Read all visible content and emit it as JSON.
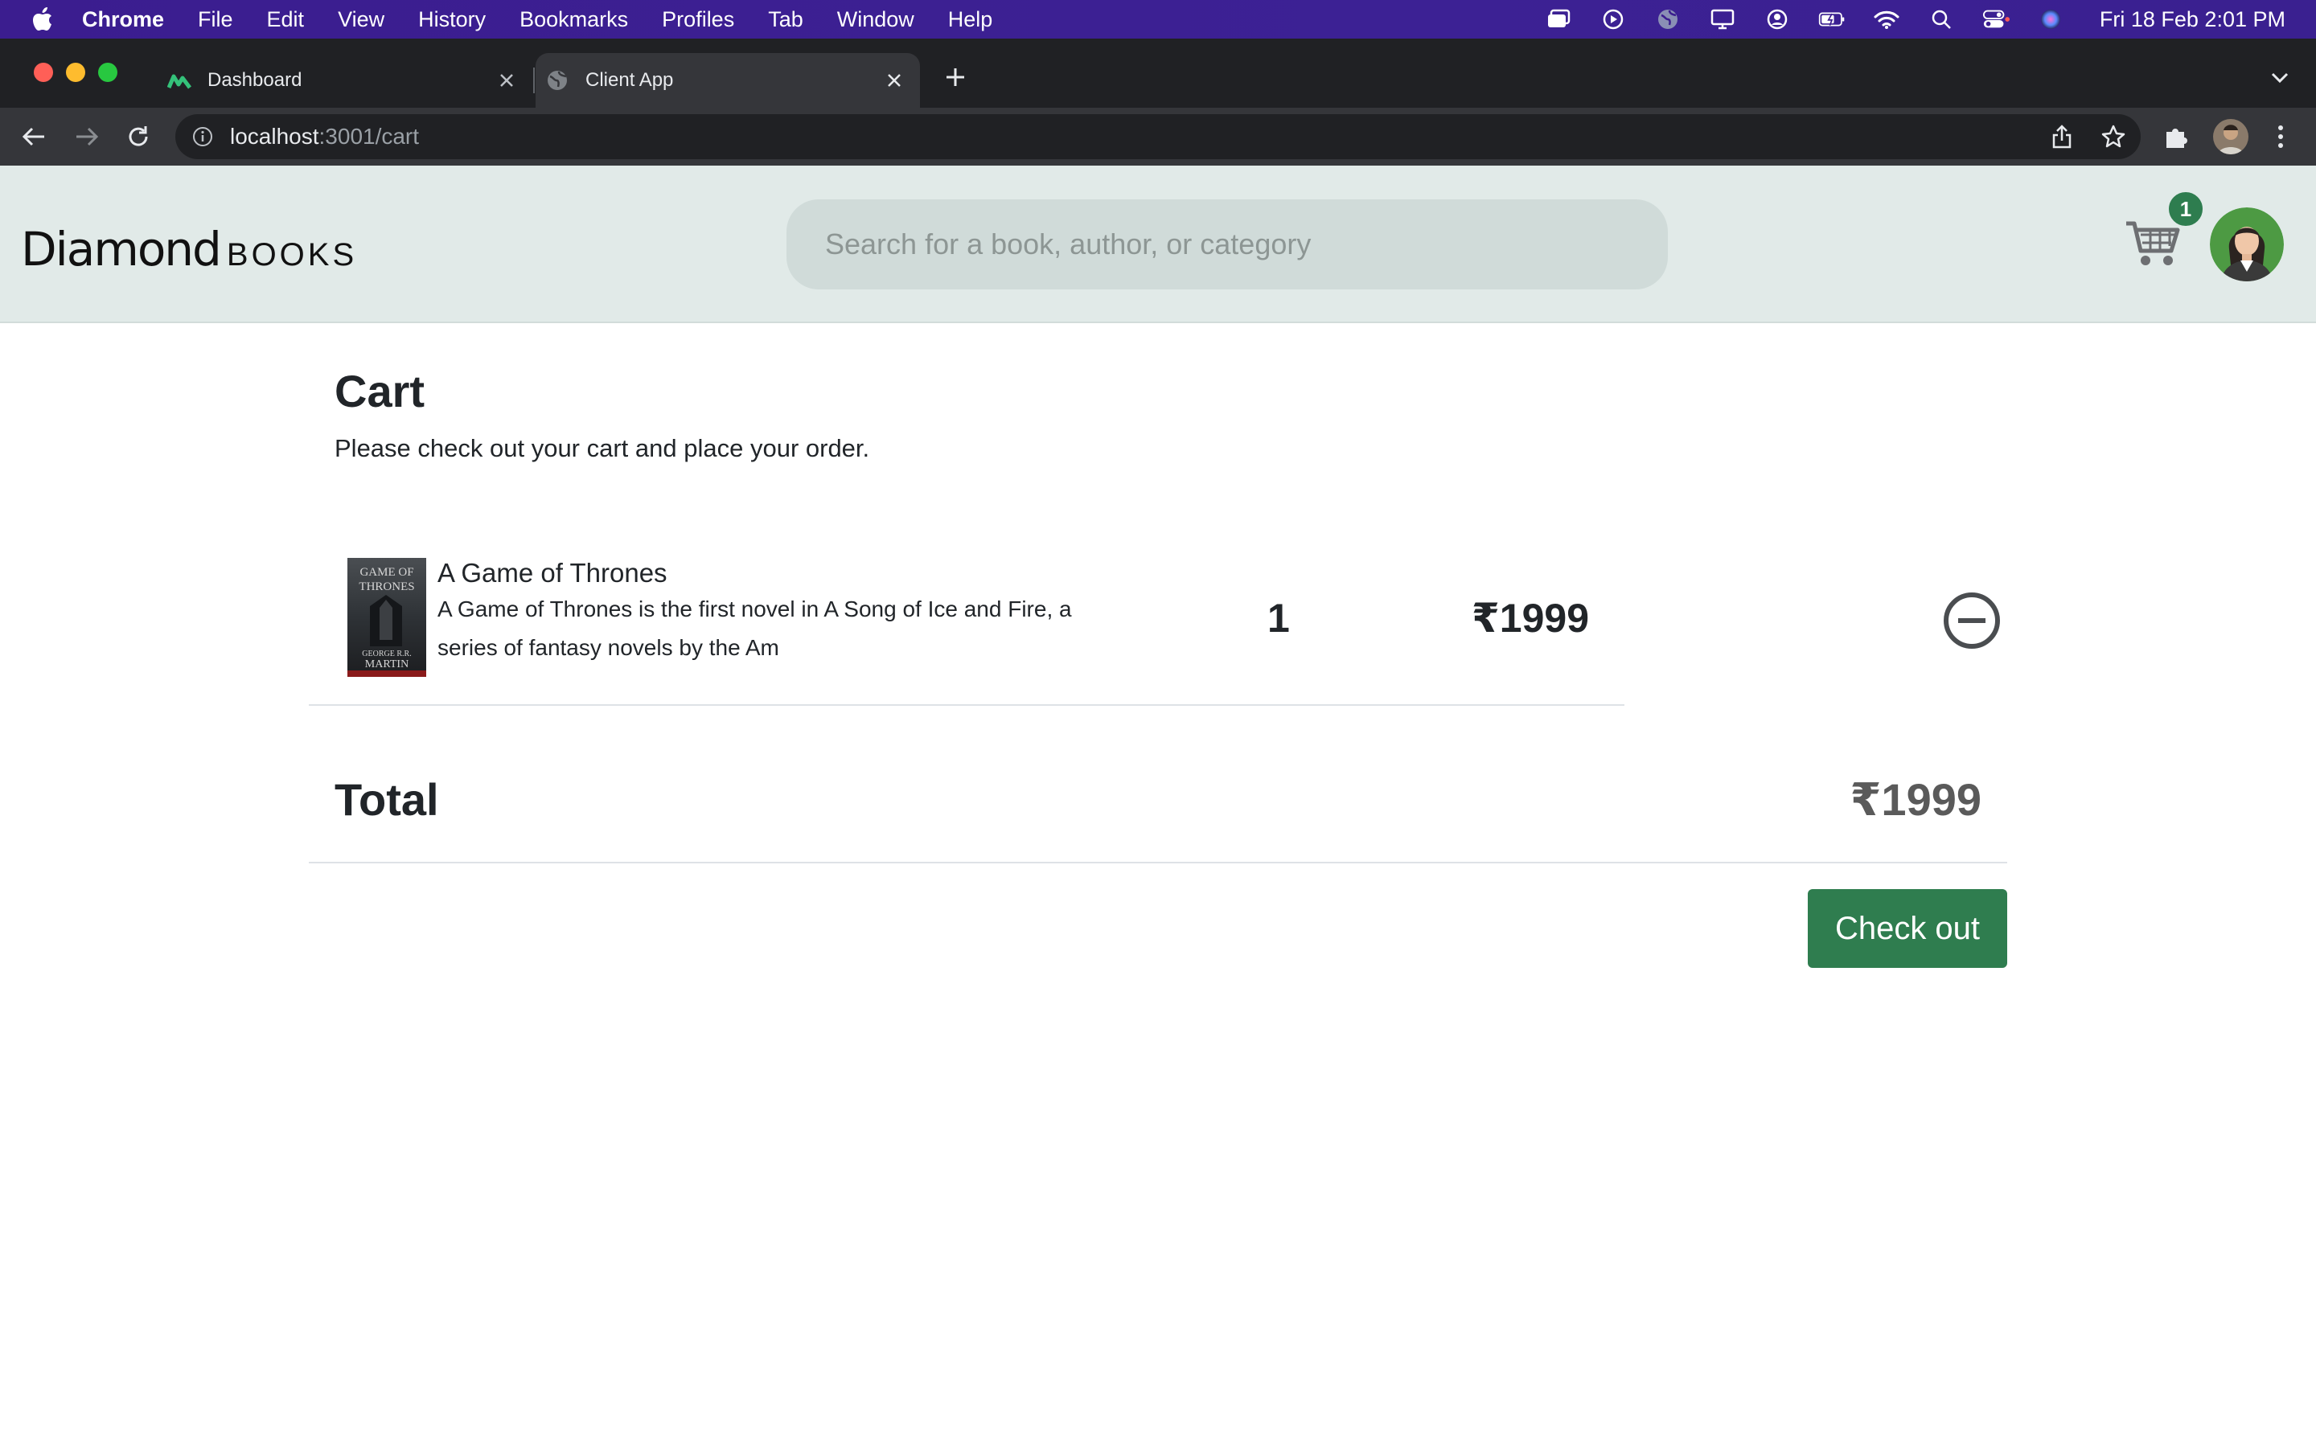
{
  "menubar": {
    "app_name": "Chrome",
    "items": [
      "File",
      "Edit",
      "View",
      "History",
      "Bookmarks",
      "Profiles",
      "Tab",
      "Window",
      "Help"
    ],
    "clock": "Fri 18 Feb  2:01 PM"
  },
  "browser": {
    "tabs": [
      {
        "title": "Dashboard",
        "icon": "dashboard-favicon",
        "active": false
      },
      {
        "title": "Client App",
        "icon": "globe-favicon",
        "active": true
      }
    ],
    "url_host": "localhost",
    "url_path": ":3001/cart"
  },
  "header": {
    "logo_main": "Diamond",
    "logo_sub": "BOOKS",
    "search_placeholder": "Search for a book, author, or category",
    "cart_count": "1"
  },
  "cart": {
    "title": "Cart",
    "subtitle": "Please check out your cart and place your order.",
    "items": [
      {
        "title": "A Game of Thrones",
        "description": "A Game of Thrones is the first novel in A Song of Ice and Fire, a series of fantasy novels by the Am",
        "quantity": "1",
        "price": "₹1999",
        "cover_text_top": "GAME of THRONES",
        "cover_text_bottom": "GEORGE R.R. MARTIN"
      }
    ],
    "total_label": "Total",
    "total_value": "₹1999",
    "checkout_label": "Check out"
  },
  "colors": {
    "menubar": "#3b1d8f",
    "header_bg": "#e1eae8",
    "accent_green": "#2f7d4f"
  }
}
